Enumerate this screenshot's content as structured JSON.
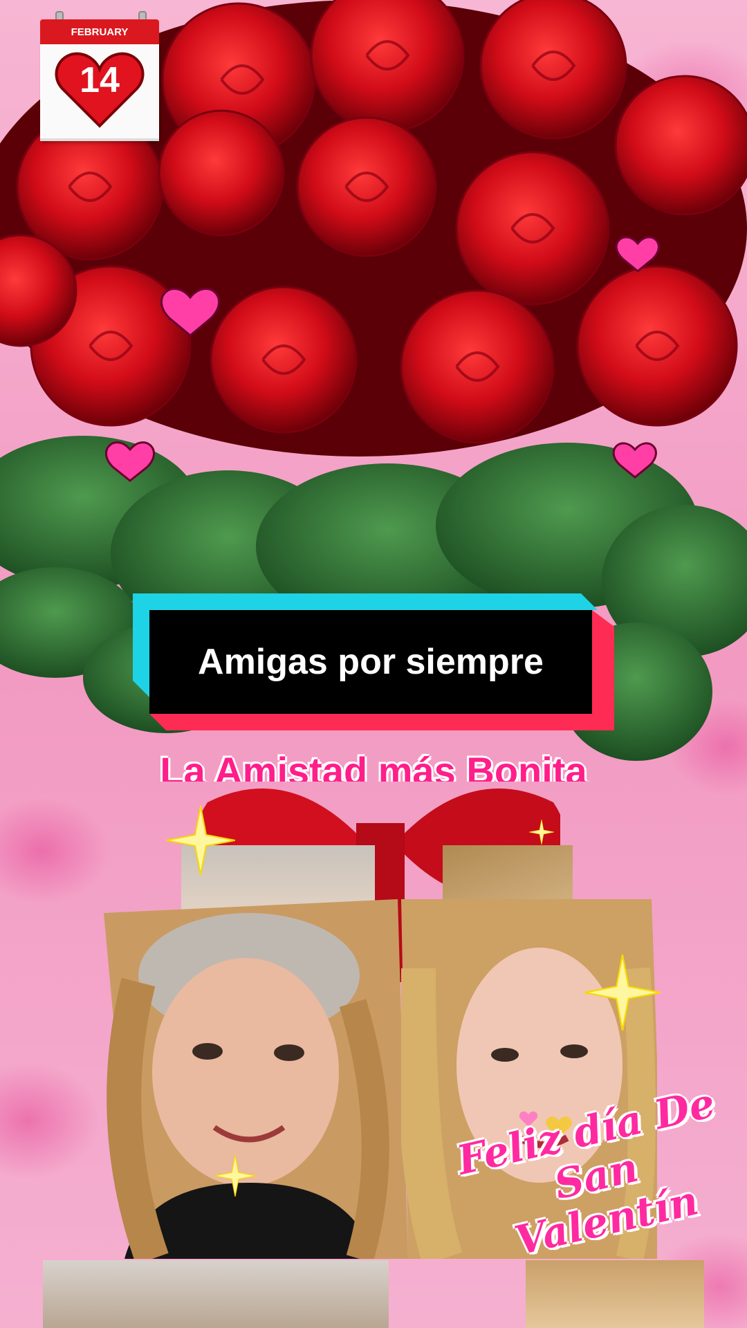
{
  "calendar": {
    "month": "FEBRUARY",
    "day": "14"
  },
  "caption": {
    "text": "Amigas por siempre"
  },
  "subtitle": {
    "text": "La Amistad más Bonita"
  },
  "greeting": {
    "line1": "Feliz día De",
    "line2": "San Valentín"
  },
  "icons": [
    "calendar-icon",
    "heart-icon",
    "sparkle-icon",
    "rose-bouquet-image",
    "photo-image"
  ],
  "colors": {
    "accent": "#ff1e8a",
    "caption_cyan": "#1fd3e6",
    "caption_red": "#fe2c55",
    "calendar_red": "#d9191f"
  }
}
